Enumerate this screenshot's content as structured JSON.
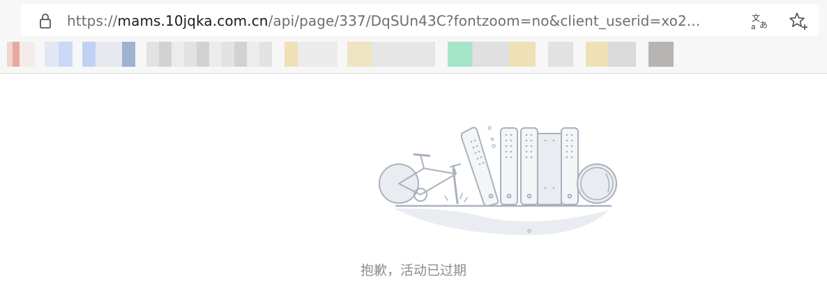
{
  "browser": {
    "url_scheme": "https://",
    "url_host": "mams.10jqka.com.cn",
    "url_path": "/api/page/337/DqSUn43C?fontzoom=no&client_userid=xo2...",
    "translate_icon": "translate-icon",
    "star_icon": "star-icon",
    "lock_icon": "lock-icon"
  },
  "colors": {
    "topbar_bg": "#f7f7f7",
    "illustration_stroke": "#a8b1bd",
    "illustration_fill": "#e9edf1",
    "message_color": "#8c8c8c"
  },
  "page": {
    "message": "抱歉，活动已过期",
    "illustration": "expired-activity-illustration"
  }
}
